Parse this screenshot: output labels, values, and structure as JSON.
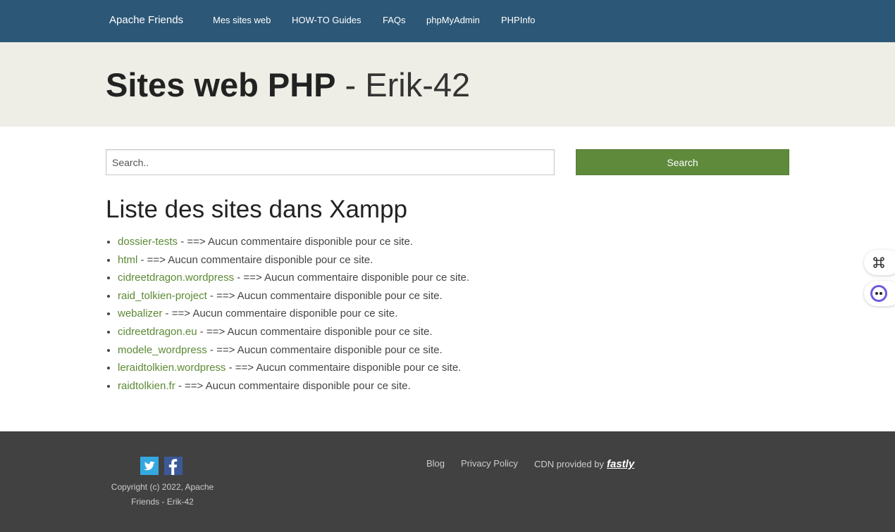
{
  "navbar": {
    "brand": "Apache Friends",
    "links": [
      "Mes sites web",
      "HOW-TO Guides",
      "FAQs",
      "phpMyAdmin",
      "PHPInfo"
    ]
  },
  "hero": {
    "title_bold": "Sites web PHP",
    "title_rest": " - Erik-42"
  },
  "search": {
    "placeholder": "Search..",
    "button_label": "Search"
  },
  "section_title": "Liste des sites dans Xampp",
  "sites": [
    {
      "name": "dossier-tests",
      "comment": " - ==> Aucun commentaire disponible pour ce site."
    },
    {
      "name": "html",
      "comment": " - ==> Aucun commentaire disponible pour ce site."
    },
    {
      "name": "cidreetdragon.wordpress",
      "comment": " - ==> Aucun commentaire disponible pour ce site."
    },
    {
      "name": "raid_tolkien-project",
      "comment": " - ==> Aucun commentaire disponible pour ce site."
    },
    {
      "name": "webalizer",
      "comment": " - ==> Aucun commentaire disponible pour ce site."
    },
    {
      "name": "cidreetdragon.eu",
      "comment": " - ==> Aucun commentaire disponible pour ce site."
    },
    {
      "name": "modele_wordpress",
      "comment": " - ==> Aucun commentaire disponible pour ce site."
    },
    {
      "name": "leraidtolkien.wordpress",
      "comment": " - ==> Aucun commentaire disponible pour ce site."
    },
    {
      "name": "raidtolkien.fr",
      "comment": " - ==> Aucun commentaire disponible pour ce site."
    }
  ],
  "footer": {
    "copyright": "Copyright (c) 2022, Apache Friends - Erik-42",
    "blog": "Blog",
    "privacy": "Privacy Policy",
    "cdn": "CDN provided by",
    "cdn_logo": "fastly",
    "social_icons": [
      "twitter-icon",
      "facebook-icon"
    ]
  },
  "floating_buttons": [
    "command-icon",
    "assistant-icon"
  ],
  "colors": {
    "navbar": "#2c5777",
    "hero": "#eeeee6",
    "accent": "#5f8a3c",
    "link": "#5c8a35",
    "footer": "#414141"
  }
}
